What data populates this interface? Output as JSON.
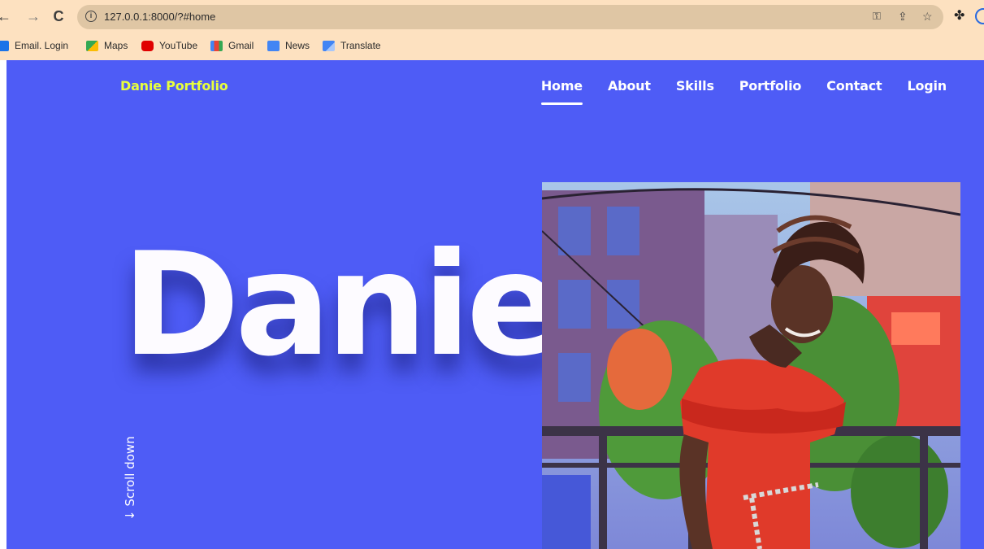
{
  "browser": {
    "url": "127.0.0.1:8000/?#home",
    "bookmarks": [
      {
        "label": "Email. Login",
        "icon": "email-icon",
        "color": "#1a73e8"
      },
      {
        "label": "Maps",
        "icon": "maps-icon",
        "color": "#34a853"
      },
      {
        "label": "YouTube",
        "icon": "youtube-icon",
        "color": "#e00000"
      },
      {
        "label": "Gmail",
        "icon": "gmail-icon",
        "color": "#ea4335"
      },
      {
        "label": "News",
        "icon": "news-icon",
        "color": "#4285f4"
      },
      {
        "label": "Translate",
        "icon": "translate-icon",
        "color": "#4285f4"
      }
    ]
  },
  "site": {
    "brand": "Danie Portfolio",
    "nav": [
      "Home",
      "About",
      "Skills",
      "Portfolio",
      "Contact",
      "Login"
    ],
    "active_nav": "Home",
    "hero_title": "Danie",
    "scroll_label": "↓ Scroll down"
  },
  "colors": {
    "background": "#4e5cf6",
    "brand": "#e8ff3c",
    "chrome": "#fde1c0"
  }
}
